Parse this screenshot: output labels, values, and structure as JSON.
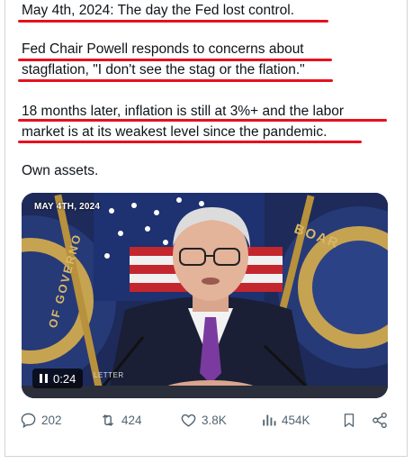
{
  "post": {
    "line1": "May 4th, 2024: The day the Fed lost control.",
    "line2": "Fed Chair Powell responds to concerns about",
    "line3": "stagflation, \"I don't see the stag or the flation.\"",
    "line4": "18 months later, inflation is still at 3%+ and the labor",
    "line5": "market is at its weakest level since the pandemic.",
    "line6": "Own assets."
  },
  "media": {
    "date_overlay": "MAY 4TH, 2024",
    "board_text_right": "BOAR",
    "board_text_left": "OF GOVERNO",
    "duration": "0:24",
    "caption_partial": "LETTER",
    "state": "playing"
  },
  "actions": {
    "replies": "202",
    "reposts": "424",
    "likes": "3.8K",
    "views": "454K"
  },
  "colors": {
    "underline": "#e8101e",
    "text": "#0f1419",
    "muted": "#536471"
  },
  "icons": [
    "pause-icon",
    "reply-icon",
    "repost-icon",
    "like-icon",
    "views-icon",
    "bookmark-icon",
    "share-icon"
  ]
}
